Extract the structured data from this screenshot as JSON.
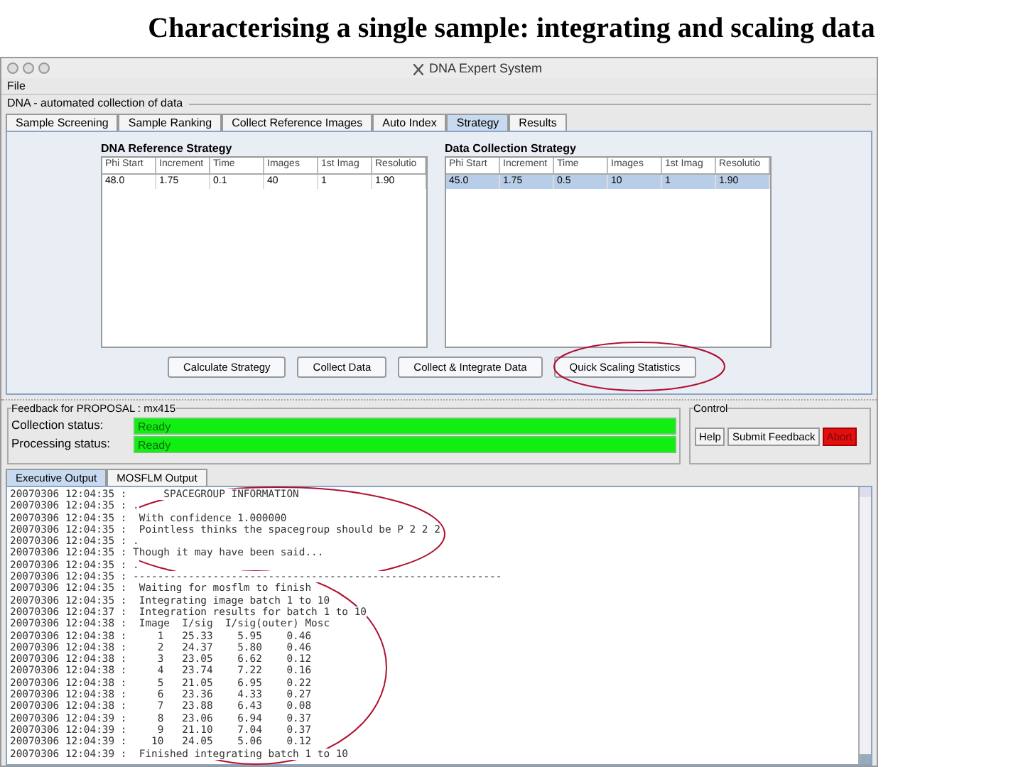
{
  "slide_title": "Characterising a single sample: integrating and scaling data",
  "window": {
    "title": "DNA Expert System",
    "menu": [
      "File"
    ],
    "group_title": "DNA - automated collection of data",
    "tabs": [
      {
        "label": "Sample Screening",
        "selected": false
      },
      {
        "label": "Sample Ranking",
        "selected": false
      },
      {
        "label": "Collect Reference Images",
        "selected": false
      },
      {
        "label": "Auto Index",
        "selected": false
      },
      {
        "label": "Strategy",
        "selected": true
      },
      {
        "label": "Results",
        "selected": false
      }
    ],
    "strategies": [
      {
        "title": "DNA Reference Strategy",
        "columns": [
          "Phi Start",
          "Increment",
          "Time",
          "Images",
          "1st Imag",
          "Resolutio"
        ],
        "rows": [
          {
            "cells": [
              "48.0",
              "1.75",
              "0.1",
              "40",
              "1",
              "1.90"
            ],
            "selected": false
          }
        ]
      },
      {
        "title": "Data Collection Strategy",
        "columns": [
          "Phi Start",
          "Increment",
          "Time",
          "Images",
          "1st Imag",
          "Resolutio"
        ],
        "rows": [
          {
            "cells": [
              "45.0",
              "1.75",
              "0.5",
              "10",
              "1",
              "1.90"
            ],
            "selected": true
          }
        ]
      }
    ],
    "buttons": [
      "Calculate Strategy",
      "Collect Data",
      "Collect & Integrate Data",
      "Quick Scaling Statistics"
    ],
    "feedback": {
      "title": "Feedback for PROPOSAL : mx415",
      "statuses": [
        {
          "label": "Collection status:",
          "value": "Ready"
        },
        {
          "label": "Processing status:",
          "value": "Ready"
        }
      ]
    },
    "control": {
      "title": "Control",
      "buttons": [
        {
          "label": "Help",
          "kind": "normal"
        },
        {
          "label": "Submit Feedback",
          "kind": "normal"
        },
        {
          "label": "Abort",
          "kind": "danger"
        }
      ]
    },
    "output_tabs": [
      {
        "label": "Executive Output",
        "selected": true
      },
      {
        "label": "MOSFLM Output",
        "selected": false
      }
    ],
    "log": [
      "20070306 12:04:35 :      SPACEGROUP INFORMATION",
      "20070306 12:04:35 : .",
      "20070306 12:04:35 :  With confidence 1.000000",
      "20070306 12:04:35 :  Pointless thinks the spacegroup should be P 2 2 2",
      "20070306 12:04:35 : .",
      "20070306 12:04:35 : Though it may have been said...",
      "20070306 12:04:35 : .",
      "20070306 12:04:35 : ------------------------------------------------------------",
      "20070306 12:04:35 :  Waiting for mosflm to finish",
      "20070306 12:04:35 :  Integrating image batch 1 to 10",
      "20070306 12:04:37 :  Integration results for batch 1 to 10",
      "20070306 12:04:38 :  Image  I/sig  I/sig(outer) Mosc",
      "20070306 12:04:38 :     1   25.33    5.95    0.46",
      "20070306 12:04:38 :     2   24.37    5.80    0.46",
      "20070306 12:04:38 :     3   23.05    6.62    0.12",
      "20070306 12:04:38 :     4   23.74    7.22    0.16",
      "20070306 12:04:38 :     5   21.05    6.95    0.22",
      "20070306 12:04:38 :     6   23.36    4.33    0.27",
      "20070306 12:04:38 :     7   23.88    6.43    0.08",
      "20070306 12:04:39 :     8   23.06    6.94    0.37",
      "20070306 12:04:39 :     9   21.10    7.04    0.37",
      "20070306 12:04:39 :    10   24.05    5.06    0.12",
      "20070306 12:04:39 :  Finished integrating batch 1 to 10"
    ]
  }
}
